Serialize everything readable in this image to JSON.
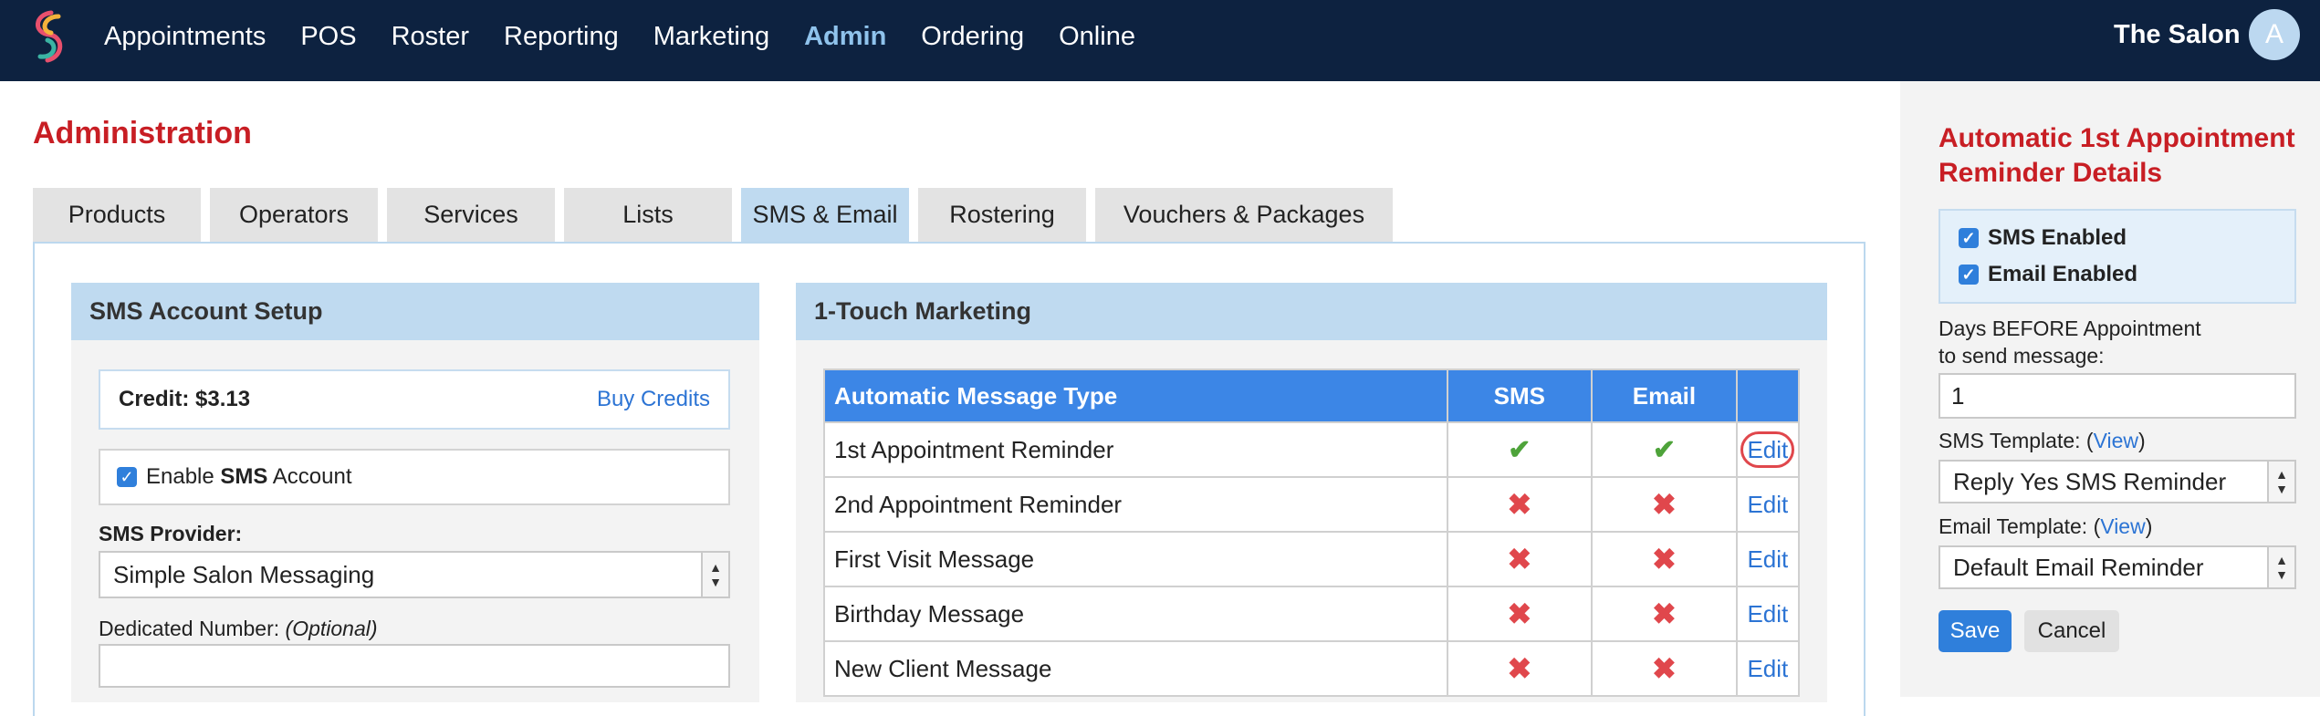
{
  "nav": {
    "items": [
      "Appointments",
      "POS",
      "Roster",
      "Reporting",
      "Marketing",
      "Admin",
      "Ordering",
      "Online"
    ],
    "active": "Admin",
    "salon_name": "The Salon",
    "avatar_initial": "A"
  },
  "page": {
    "title": "Administration"
  },
  "tabs": [
    "Products",
    "Operators",
    "Services",
    "Lists",
    "SMS & Email",
    "Rostering",
    "Vouchers & Packages"
  ],
  "active_tab": "SMS & Email",
  "sms_setup": {
    "header": "SMS Account Setup",
    "credit_label": "Credit: $3.13",
    "buy_credits": "Buy Credits",
    "enable_prefix": "Enable ",
    "enable_bold": "SMS",
    "enable_suffix": " Account",
    "provider_label": "SMS Provider:",
    "provider_value": "Simple Salon Messaging",
    "dedicated_label": "Dedicated Number: ",
    "dedicated_optional": "(Optional)",
    "dedicated_value": ""
  },
  "marketing": {
    "header": "1-Touch Marketing",
    "columns": [
      "Automatic Message Type",
      "SMS",
      "Email",
      ""
    ],
    "rows": [
      {
        "type": "1st Appointment Reminder",
        "sms": "check",
        "email": "check",
        "action": "Edit"
      },
      {
        "type": "2nd Appointment Reminder",
        "sms": "cross",
        "email": "cross",
        "action": "Edit"
      },
      {
        "type": "First Visit Message",
        "sms": "cross",
        "email": "cross",
        "action": "Edit"
      },
      {
        "type": "Birthday Message",
        "sms": "cross",
        "email": "cross",
        "action": "Edit"
      },
      {
        "type": "New Client Message",
        "sms": "cross",
        "email": "cross",
        "action": "Edit"
      }
    ]
  },
  "detail": {
    "title": "Automatic 1st Appointment Reminder Details",
    "sms_enabled": "SMS Enabled",
    "email_enabled": "Email Enabled",
    "days_label_1": "Days BEFORE Appointment",
    "days_label_2": "to send message:",
    "days_value": "1",
    "sms_template_label": "SMS Template: (",
    "view_link": "View",
    "close_paren": ")",
    "sms_template_value": "Reply Yes SMS Reminder",
    "email_template_label": "Email Template: (",
    "email_template_value": "Default Email Reminder",
    "save": "Save",
    "cancel": "Cancel"
  },
  "colors": {
    "nav_bg": "#0d2240",
    "accent": "#2f7fdb",
    "title_red": "#c81e24",
    "panel_header": "#bfdaf0"
  }
}
